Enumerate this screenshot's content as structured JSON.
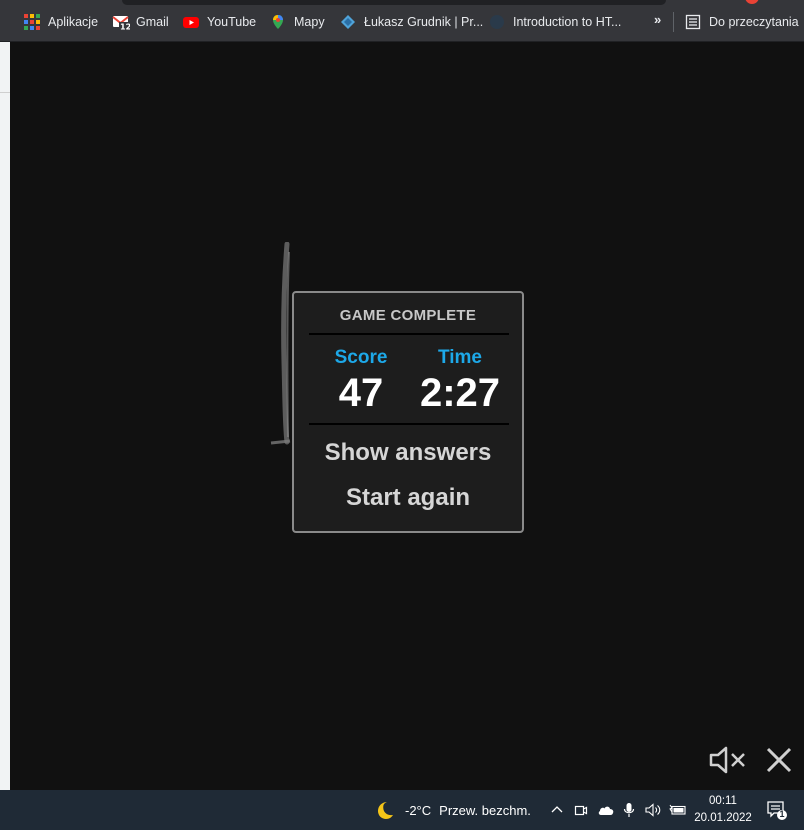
{
  "bookmarks": [
    {
      "label": "Aplikacje",
      "icon": "apps-grid-icon"
    },
    {
      "label": "Gmail",
      "icon": "gmail-icon"
    },
    {
      "label": "YouTube",
      "icon": "youtube-icon"
    },
    {
      "label": "Mapy",
      "icon": "maps-pin-icon"
    },
    {
      "label": "Łukasz Grudnik | Pr...",
      "icon": "diamond-logo-icon"
    },
    {
      "label": "Introduction to HT...",
      "icon": "globe-icon"
    }
  ],
  "reading_list": {
    "label": "Do przeczytania"
  },
  "overflow_label": "»",
  "game_complete": {
    "title": "GAME COMPLETE",
    "score_label": "Score",
    "score_value": "47",
    "time_label": "Time",
    "time_value": "2:27",
    "show_answers": "Show answers",
    "start_again": "Start again"
  },
  "taskbar": {
    "temperature": "-2°C",
    "weather_text": "Przew. bezchm.",
    "time": "00:11",
    "date": "20.01.2022",
    "notification_count": "1"
  },
  "colors": {
    "accent": "#1da8e8",
    "background": "#111111",
    "taskbar": "#1f2a36"
  }
}
